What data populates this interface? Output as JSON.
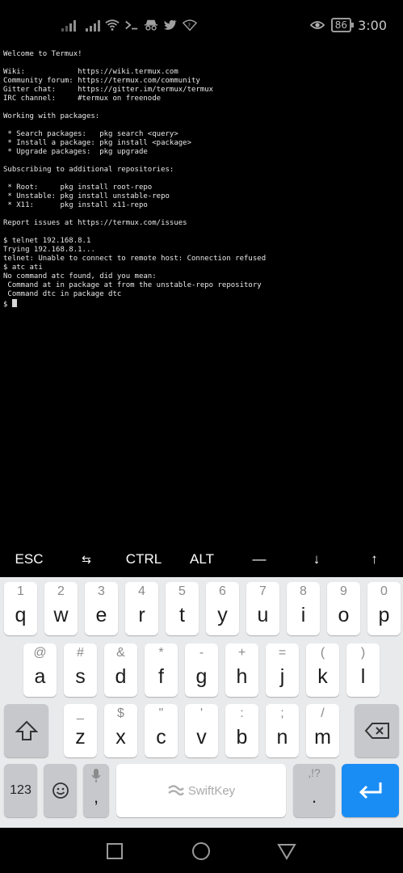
{
  "status_bar": {
    "battery": "86",
    "time": "3:00",
    "icons": [
      "signal-icon",
      "signal-icon",
      "wifi-icon",
      "terminal-icon",
      "incognito-icon",
      "twitter-icon",
      "wifi-question-icon",
      "eye-icon",
      "battery-icon"
    ]
  },
  "terminal": {
    "lines": [
      "Welcome to Termux!",
      "",
      "Wiki:            https://wiki.termux.com",
      "Community forum: https://termux.com/community",
      "Gitter chat:     https://gitter.im/termux/termux",
      "IRC channel:     #termux on freenode",
      "",
      "Working with packages:",
      "",
      " * Search packages:   pkg search <query>",
      " * Install a package: pkg install <package>",
      " * Upgrade packages:  pkg upgrade",
      "",
      "Subscribing to additional repositories:",
      "",
      " * Root:     pkg install root-repo",
      " * Unstable: pkg install unstable-repo",
      " * X11:      pkg install x11-repo",
      "",
      "Report issues at https://termux.com/issues",
      "",
      "$ telnet 192.168.8.1",
      "Trying 192.168.8.1...",
      "telnet: Unable to connect to remote host: Connection refused",
      "$ atc ati",
      "No command atc found, did you mean:",
      " Command at in package at from the unstable-repo repository",
      " Command dtc in package dtc"
    ],
    "prompt": "$ "
  },
  "extra_keys": {
    "esc": "ESC",
    "tab": "⇆",
    "ctrl": "CTRL",
    "alt": "ALT",
    "dash": "—",
    "down": "↓",
    "up": "↑"
  },
  "keyboard": {
    "row1": [
      {
        "top": "1",
        "main": "q"
      },
      {
        "top": "2",
        "main": "w"
      },
      {
        "top": "3",
        "main": "e"
      },
      {
        "top": "4",
        "main": "r"
      },
      {
        "top": "5",
        "main": "t"
      },
      {
        "top": "6",
        "main": "y"
      },
      {
        "top": "7",
        "main": "u"
      },
      {
        "top": "8",
        "main": "i"
      },
      {
        "top": "9",
        "main": "o"
      },
      {
        "top": "0",
        "main": "p"
      }
    ],
    "row2": [
      {
        "top": "@",
        "main": "a"
      },
      {
        "top": "#",
        "main": "s"
      },
      {
        "top": "&",
        "main": "d"
      },
      {
        "top": "*",
        "main": "f"
      },
      {
        "top": "-",
        "main": "g"
      },
      {
        "top": "+",
        "main": "h"
      },
      {
        "top": "=",
        "main": "j"
      },
      {
        "top": "(",
        "main": "k"
      },
      {
        "top": ")",
        "main": "l"
      }
    ],
    "row3": [
      {
        "top": "_",
        "main": "z"
      },
      {
        "top": "$",
        "main": "x"
      },
      {
        "top": "\"",
        "main": "c"
      },
      {
        "top": "'",
        "main": "v"
      },
      {
        "top": ":",
        "main": "b"
      },
      {
        "top": ";",
        "main": "n"
      },
      {
        "top": "/",
        "main": "m"
      }
    ],
    "numbers_label": "123",
    "comma": ",",
    "space_label": "SwiftKey",
    "punct_top": ",!?",
    "punct_main": "."
  },
  "colors": {
    "terminal_bg": "#000000",
    "keyboard_bg": "#e9eaec",
    "enter_key": "#1a8df5"
  }
}
